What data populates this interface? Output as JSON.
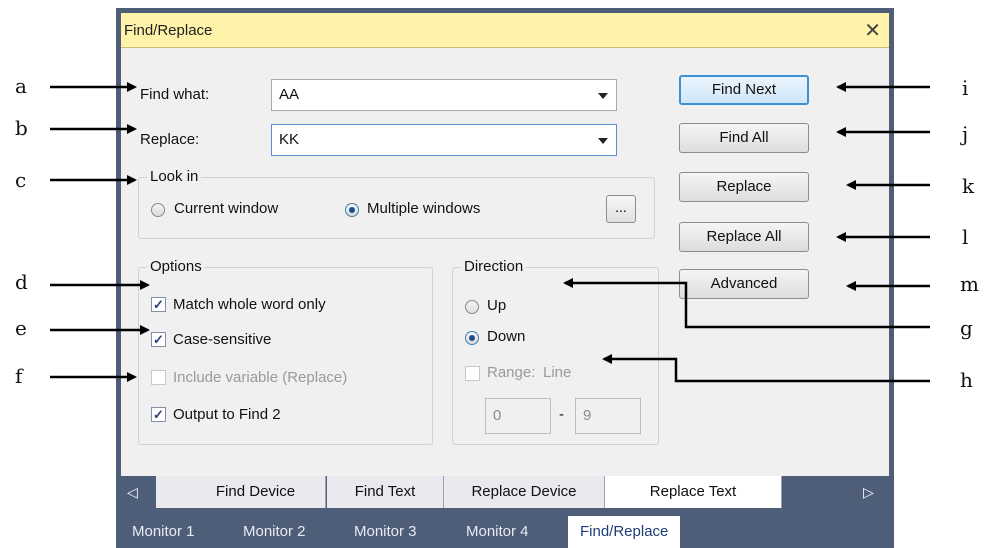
{
  "dialog": {
    "title": "Find/Replace",
    "close_icon": "close-icon"
  },
  "find": {
    "label": "Find what:",
    "value": "AA"
  },
  "replace": {
    "label": "Replace:",
    "value": "KK"
  },
  "look_in": {
    "title": "Look in",
    "current_window": "Current window",
    "multiple_windows": "Multiple windows",
    "selected": "Multiple windows",
    "browse_label": "..."
  },
  "options": {
    "title": "Options",
    "match_whole_word": {
      "label": "Match whole word only",
      "checked": true
    },
    "case_sensitive": {
      "label": "Case-sensitive",
      "checked": true
    },
    "include_variable": {
      "label": "Include variable (Replace)",
      "checked": false,
      "disabled": true
    },
    "output_find2": {
      "label": "Output to Find 2",
      "checked": true
    }
  },
  "direction": {
    "title": "Direction",
    "up": "Up",
    "down": "Down",
    "selected": "Down",
    "range_label": "Range:",
    "range_unit": "Line",
    "range_from": "0",
    "range_sep": "-",
    "range_to": "9"
  },
  "buttons": {
    "find_next": "Find Next",
    "find_all": "Find All",
    "replace": "Replace",
    "replace_all": "Replace All",
    "advanced": "Advanced"
  },
  "tabs": [
    "Find Device",
    "Find Text",
    "Replace Device",
    "Replace Text"
  ],
  "active_tab": "Replace Text",
  "bottom_tabs": [
    "Monitor 1",
    "Monitor 2",
    "Monitor 3",
    "Monitor 4",
    "Find/Replace"
  ],
  "active_bottom_tab": "Find/Replace",
  "callouts": {
    "left": [
      "a",
      "b",
      "c",
      "d",
      "e",
      "f"
    ],
    "right": [
      "i",
      "j",
      "k",
      "l",
      "m",
      "g",
      "h"
    ]
  },
  "colors": {
    "title_bar": "#fff3a9",
    "frame": "#4e5d78",
    "default_button_border": "#3c91d6"
  }
}
